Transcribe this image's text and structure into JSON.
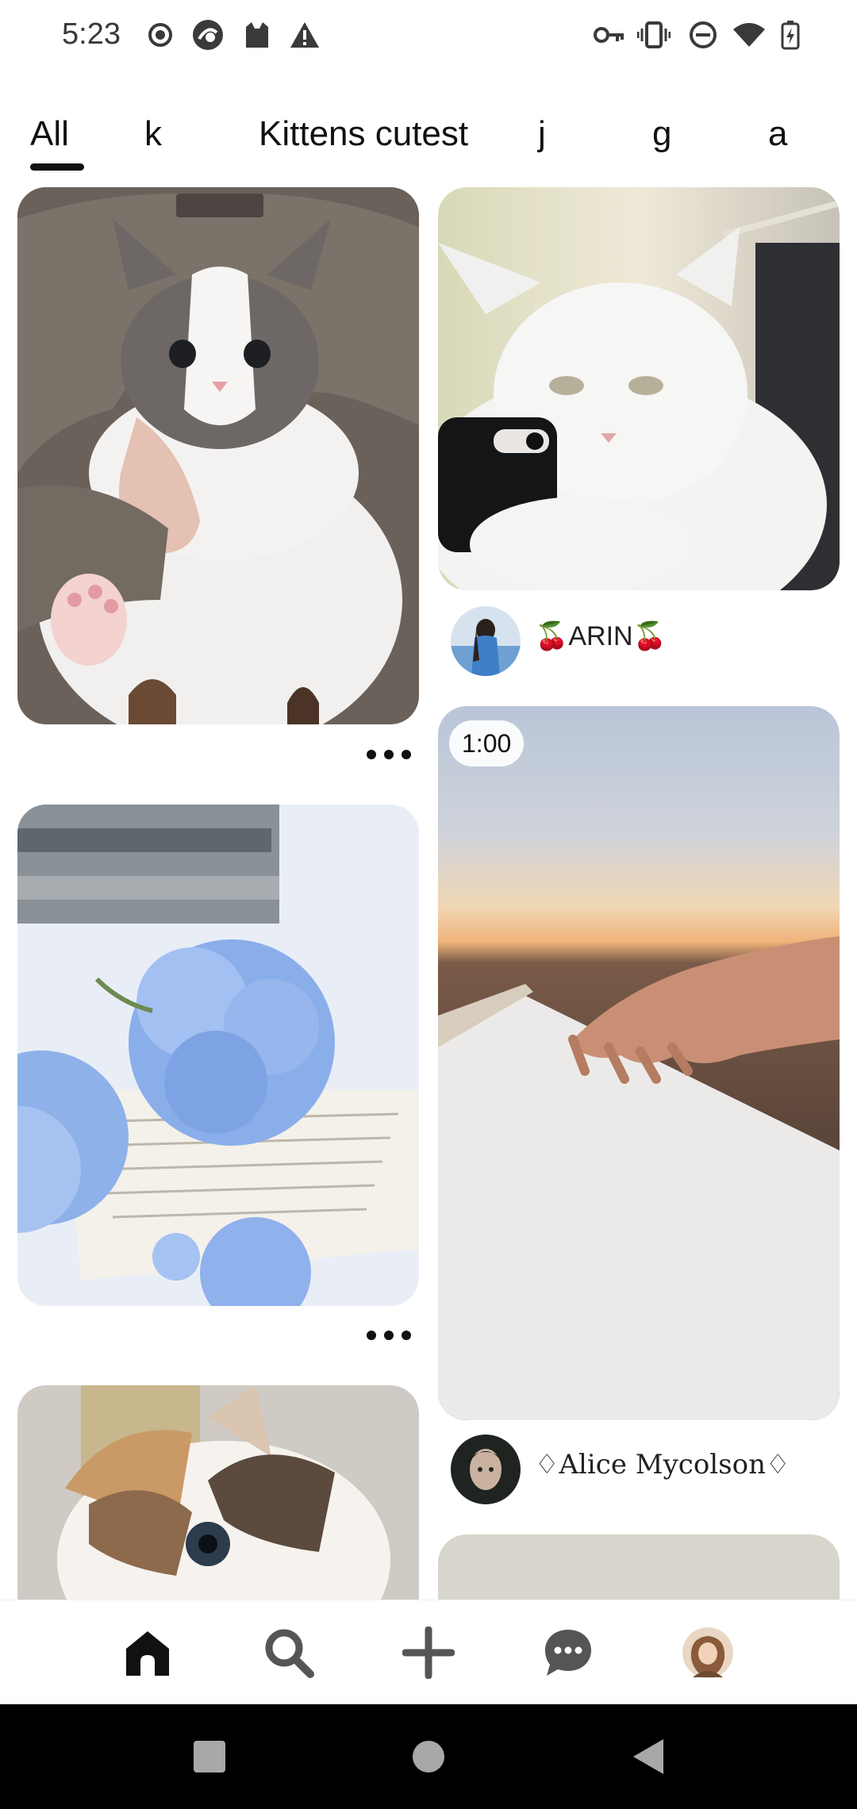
{
  "status_bar": {
    "time": "5:23",
    "left_icons": [
      "record-icon",
      "browser-icon",
      "cat-app-icon",
      "warning-icon"
    ],
    "right_icons": [
      "vpn-key-icon",
      "vibrate-icon",
      "do-not-disturb-icon",
      "wifi-icon",
      "battery-charging-icon"
    ]
  },
  "tabs": [
    {
      "label": "All",
      "selected": true
    },
    {
      "label": "k",
      "selected": false
    },
    {
      "label": "Kittens cutest",
      "selected": false
    },
    {
      "label": "j",
      "selected": false
    },
    {
      "label": "g",
      "selected": false
    },
    {
      "label": "a",
      "selected": false
    }
  ],
  "feed": {
    "left_column": [
      {
        "image": "grey-white-kitten-photo",
        "author": ""
      },
      {
        "image": "blue-hydrangea-on-book-photo",
        "author": ""
      },
      {
        "image": "calico-kitten-photo",
        "author": ""
      }
    ],
    "right_column": [
      {
        "image": "white-cat-with-phone-photo",
        "author": "🍒ARIN🍒"
      },
      {
        "image": "piano-sunset-video",
        "duration": "1:00",
        "author": "♢Alice Mycolson♢"
      },
      {
        "image": "beige-placeholder",
        "author": ""
      }
    ]
  },
  "bottom_nav": [
    {
      "icon": "home-icon",
      "label": "Home",
      "active": true
    },
    {
      "icon": "search-icon",
      "label": "Search",
      "active": false
    },
    {
      "icon": "plus-icon",
      "label": "Create",
      "active": false
    },
    {
      "icon": "chat-icon",
      "label": "Messages",
      "active": false
    },
    {
      "icon": "profile-avatar",
      "label": "Profile",
      "active": false
    }
  ],
  "system_nav": [
    "recents-button",
    "home-button",
    "back-button"
  ],
  "colors": {
    "text": "#111111",
    "status_text": "#3a3a3a",
    "background": "#ffffff",
    "system_nav": "#000000"
  }
}
